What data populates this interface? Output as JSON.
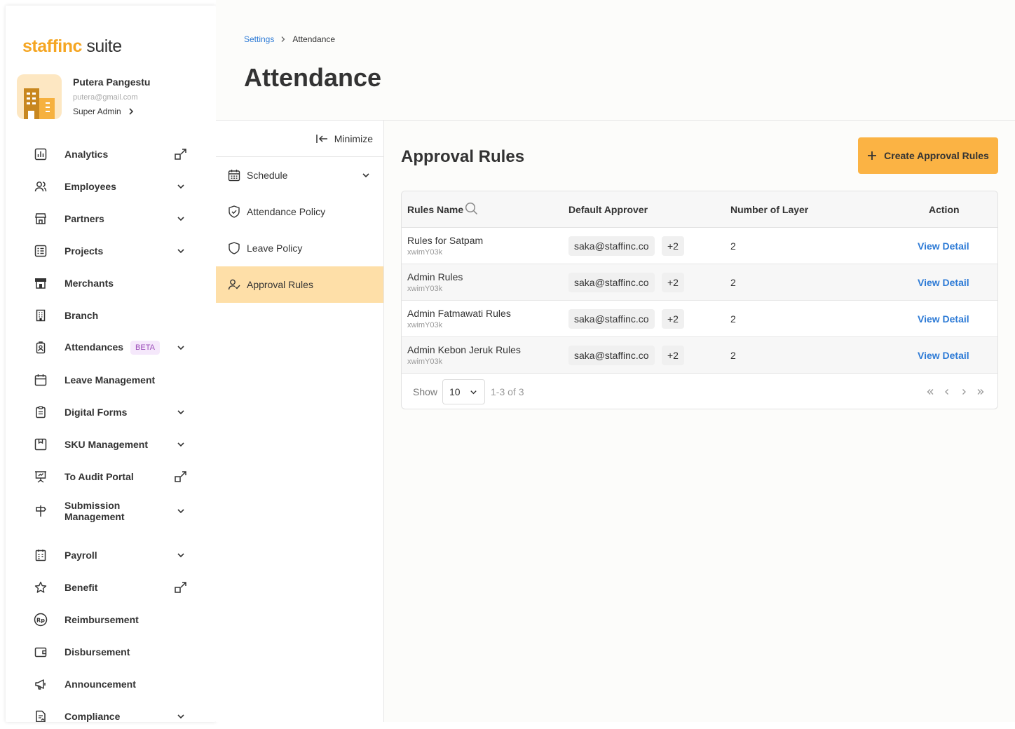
{
  "brand": {
    "logo_part1": "staffinc",
    "logo_part2": " suite",
    "accent": "#fbb344"
  },
  "user": {
    "name": "Putera Pangestu",
    "email": "putera@gmail.com",
    "role": "Super Admin"
  },
  "nav": [
    {
      "label": "Analytics",
      "icon": "chart-icon",
      "trail": "external"
    },
    {
      "label": "Employees",
      "icon": "users-icon",
      "trail": "chevron"
    },
    {
      "label": "Partners",
      "icon": "store-icon",
      "trail": "chevron"
    },
    {
      "label": "Projects",
      "icon": "list-icon",
      "trail": "chevron"
    },
    {
      "label": "Merchants",
      "icon": "merchant-icon",
      "trail": "none"
    },
    {
      "label": "Branch",
      "icon": "building-icon",
      "trail": "none"
    },
    {
      "label": "Attendances",
      "icon": "badge-icon",
      "trail": "chevron",
      "badge": "BETA"
    },
    {
      "label": "Leave Management",
      "icon": "calendar-icon",
      "trail": "none"
    },
    {
      "label": "Digital Forms",
      "icon": "clipboard-icon",
      "trail": "chevron"
    },
    {
      "label": "SKU Management",
      "icon": "box-icon",
      "trail": "chevron"
    },
    {
      "label": "To Audit Portal",
      "icon": "presentation-icon",
      "trail": "external"
    },
    {
      "label": "Submission Management",
      "icon": "signpost-icon",
      "trail": "chevron"
    },
    {
      "label": "Payroll",
      "icon": "payroll-icon",
      "trail": "chevron"
    },
    {
      "label": "Benefit",
      "icon": "star-icon",
      "trail": "external"
    },
    {
      "label": "Reimbursement",
      "icon": "rupiah-icon",
      "trail": "none"
    },
    {
      "label": "Disbursement",
      "icon": "wallet-icon",
      "trail": "none"
    },
    {
      "label": "Announcement",
      "icon": "megaphone-icon",
      "trail": "none"
    },
    {
      "label": "Compliance",
      "icon": "document-icon",
      "trail": "chevron"
    }
  ],
  "breadcrumb": {
    "parent": "Settings",
    "current": "Attendance"
  },
  "page_title": "Attendance",
  "subnav": {
    "minimize_label": "Minimize",
    "items": [
      {
        "label": "Schedule",
        "icon": "calendar-grid-icon",
        "has_chevron": true,
        "active": false
      },
      {
        "label": "Attendance Policy",
        "icon": "shield-check-icon",
        "has_chevron": false,
        "active": false
      },
      {
        "label": "Leave Policy",
        "icon": "shield-icon",
        "has_chevron": false,
        "active": false
      },
      {
        "label": "Approval Rules",
        "icon": "user-check-icon",
        "has_chevron": false,
        "active": true
      }
    ]
  },
  "section": {
    "title": "Approval Rules",
    "create_label": "Create Approval Rules"
  },
  "table": {
    "headers": {
      "name": "Rules Name",
      "approver": "Default Approver",
      "layers": "Number of Layer",
      "action": "Action"
    },
    "rows": [
      {
        "name": "Rules for Satpam",
        "code": "xwimY03k",
        "approver": "saka@staffinc.co",
        "extra": "+2",
        "layers": "2",
        "action": "View Detail"
      },
      {
        "name": "Admin Rules",
        "code": "xwimY03k",
        "approver": "saka@staffinc.co",
        "extra": "+2",
        "layers": "2",
        "action": "View Detail"
      },
      {
        "name": "Admin Fatmawati Rules",
        "code": "xwimY03k",
        "approver": "saka@staffinc.co",
        "extra": "+2",
        "layers": "2",
        "action": "View Detail"
      },
      {
        "name": "Admin Kebon Jeruk Rules",
        "code": "xwimY03k",
        "approver": "saka@staffinc.co",
        "extra": "+2",
        "layers": "2",
        "action": "View Detail"
      }
    ],
    "footer": {
      "show_label": "Show",
      "page_size": "10",
      "range": "1-3 of 3"
    }
  }
}
